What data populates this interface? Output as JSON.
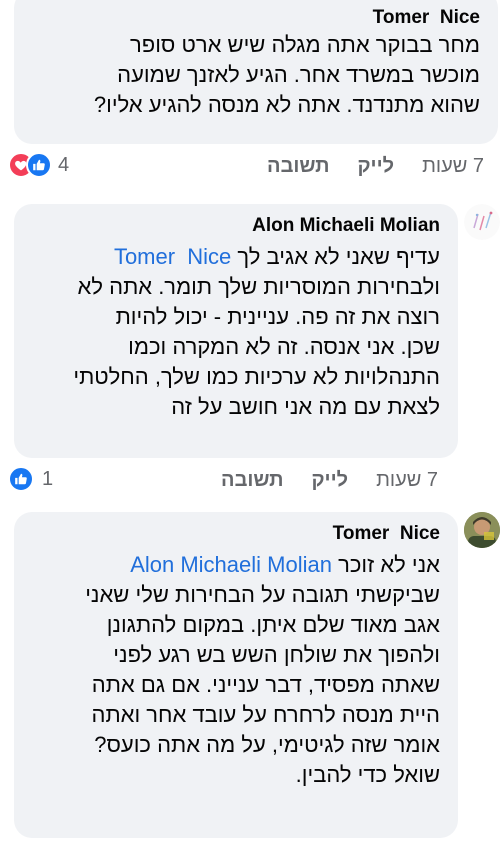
{
  "comments": [
    {
      "author": "Tomer  Nice",
      "lines": [
        "מחר בבוקר אתה מגלה שיש ארט סופר",
        "מוכשר במשרד אחר. הגיע לאזנך שמועה",
        "שהוא מתנדנד. אתה לא מנסה להגיע אליו?"
      ],
      "time": "7 שעות",
      "like_label": "לייק",
      "reply_label": "תשובה",
      "reaction_count": "4",
      "reactions": [
        "like-icon",
        "love-icon"
      ]
    },
    {
      "author": "Alon Michaeli Molian",
      "mention": "Tomer  Nice",
      "first_line_rest": "עדיף שאני לא אגיב לך",
      "lines": [
        "ולבחירות המוסריות שלך תומר. אתה לא",
        "רוצה את זה פה. עניינית - יכול להיות",
        "שכן. אני אנסה. זה לא המקרה וכמו",
        "התנהלויות לא ערכיות כמו שלך, החלטתי",
        "לצאת עם מה אני חושב על זה"
      ],
      "time": "7 שעות",
      "like_label": "לייק",
      "reply_label": "תשובה",
      "reaction_count": "1",
      "reactions": [
        "like-icon"
      ]
    },
    {
      "author": "Tomer  Nice",
      "mention": "Alon Michaeli Molian",
      "first_line_rest": "אני לא זוכר",
      "lines": [
        "שביקשתי תגובה על הבחירות שלי שאני",
        "אגב מאוד שלם איתן. במקום להתגונן",
        "ולהפוך את שולחן השש בש רגע לפני",
        "שאתה מפסיד, דבר ענייני. אם גם אתה",
        "היית מנסה לרחרח על עובד אחר ואתה",
        "אומר שזה לגיטימי, על מה אתה כועס?",
        "שואל כדי להבין."
      ]
    }
  ],
  "colors": {
    "bubble": "#f0f2f5",
    "mention": "#216fdb",
    "meta": "#65676b",
    "like": "#1877f2",
    "love": "#f33e58"
  }
}
